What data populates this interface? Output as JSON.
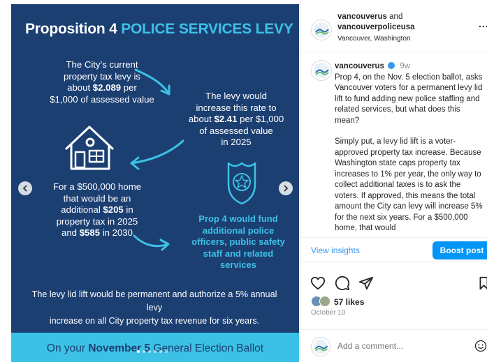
{
  "image": {
    "headline_1": "Proposition 4",
    "headline_2": "POLICE SERVICES LEVY",
    "current_1": "The City’s current",
    "current_2": "property tax levy is",
    "current_3a": "about ",
    "current_3b": "$2.089",
    "current_3c": " per",
    "current_4": "$1,000 of assessed value",
    "increase_1": "The levy would",
    "increase_2": "increase this rate to",
    "increase_3a": "about ",
    "increase_3b": "$2.41",
    "increase_3c": " per $1,000",
    "increase_4": "of assessed value",
    "increase_5": "in 2025",
    "home_1": "For a $500,000 home",
    "home_2": "that would be an",
    "home_3a": "additional ",
    "home_3b": "$205",
    "home_3c": " in",
    "home_4": "property tax in 2025",
    "home_5a": "and ",
    "home_5b": "$585",
    "home_5c": " in 2030",
    "fund_1": "Prop 4 would fund",
    "fund_2": "additional police",
    "fund_3": "officers, public safety",
    "fund_4": "staff and related",
    "fund_5": "services",
    "lid_1": "The levy lid lift would be permanent and authorize a 5% annual levy",
    "lid_2": "increase on all City property tax revenue for six years.",
    "ballot_a": "On your ",
    "ballot_b": "November 5",
    "ballot_c": " General Election Ballot",
    "colors": {
      "navy": "#1c3f72",
      "cyan": "#3cc1e6"
    }
  },
  "header": {
    "author_1": "vancouverus",
    "and": " and",
    "author_2": "vancouverpoliceusa",
    "location": "Vancouver, Washington",
    "more": "..."
  },
  "caption": {
    "username": "vancouverus",
    "time": "9w",
    "para_1": "Prop 4, on the Nov. 5 election ballot, asks Vancouver voters for a permanent levy lid lift to fund adding new police staffing and related services, but what does this mean?",
    "para_2": "Simply put, a levy lid lift is a voter-approved property tax increase. Because Washington state caps property tax increases to 1% per year, the only way to collect additional taxes is to ask the voters. If approved, this means the total amount the City can levy will increase 5% for the next six years. For a $500,000 home, that would"
  },
  "actions": {
    "view_insights": "View insights",
    "boost_post": "Boost post",
    "likes": "57 likes",
    "date": "October 10"
  },
  "comment": {
    "placeholder": "Add a comment..."
  }
}
